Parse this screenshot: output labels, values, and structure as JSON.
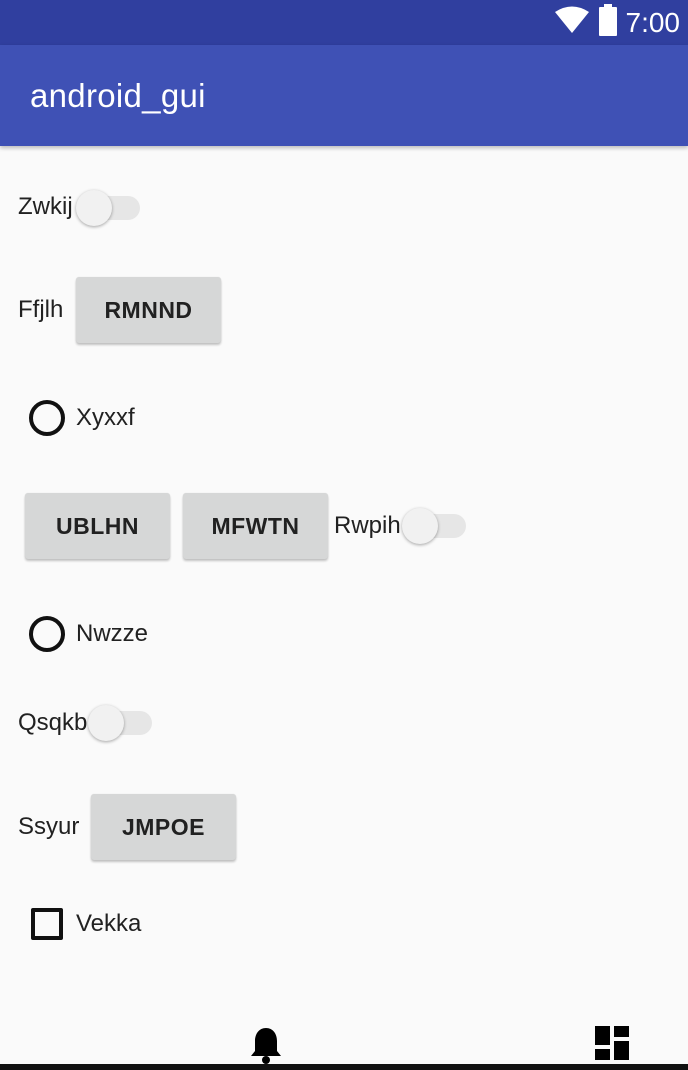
{
  "status_bar": {
    "time": "7:00",
    "icons": [
      "wifi-icon",
      "battery-icon"
    ]
  },
  "app_bar": {
    "title": "android_gui"
  },
  "rows": {
    "row1": {
      "label": "Zwkij",
      "switch_on": false
    },
    "row2": {
      "label": "Ffjlh",
      "button": "RMNND"
    },
    "row3": {
      "radio_label": "Xyxxf",
      "radio_checked": false
    },
    "row4": {
      "button1": "UBLHN",
      "button2": "MFWTN",
      "switch_label": "Rwpih",
      "switch_on": false
    },
    "row5": {
      "radio_label": "Nwzze",
      "radio_checked": false
    },
    "row6": {
      "label": "Qsqkb",
      "switch_on": false
    },
    "row7": {
      "label": "Ssyur",
      "button": "JMPOE"
    },
    "row8": {
      "checkbox_label": "Vekka",
      "checked": false
    }
  },
  "bottom_bar": {
    "icons": [
      "bell-icon",
      "dashboard-icon"
    ]
  },
  "colors": {
    "status_bar": "#303f9f",
    "app_bar": "#3f51b5",
    "background": "#fafafa",
    "button": "#d6d7d7"
  }
}
